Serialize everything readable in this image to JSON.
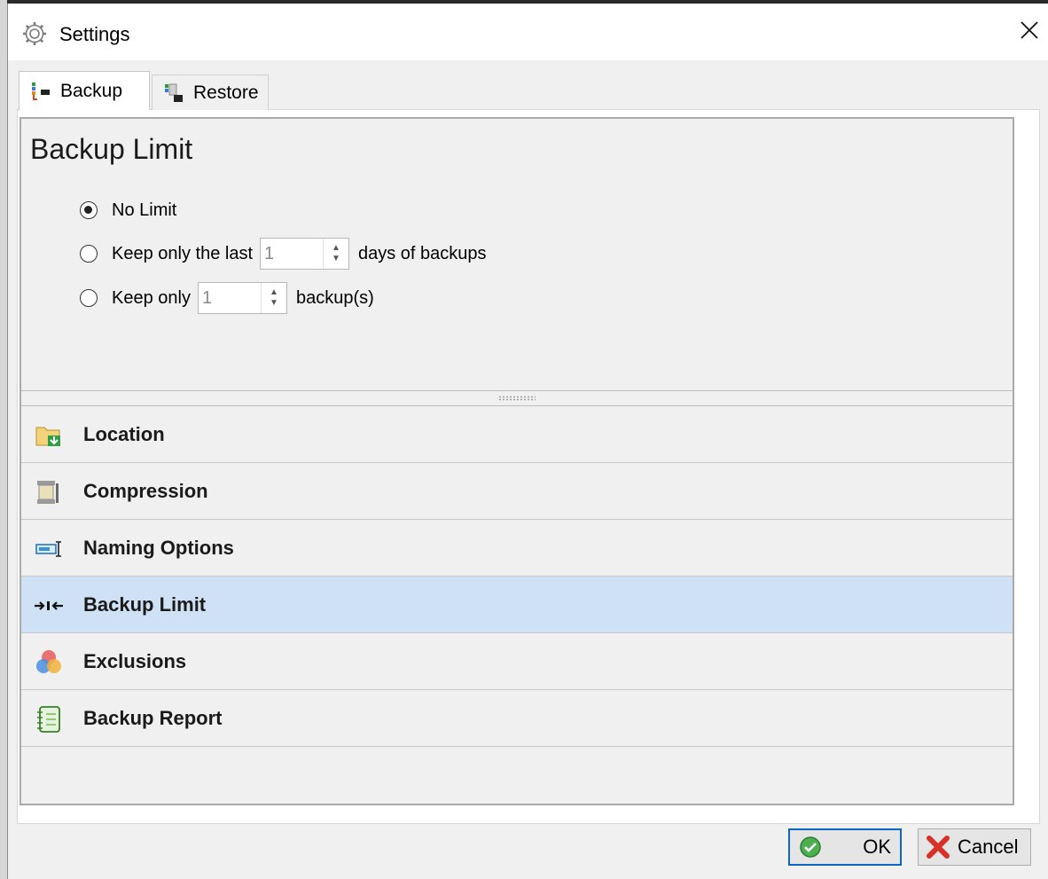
{
  "window": {
    "title": "Settings",
    "close_glyph": "✕"
  },
  "tabs": [
    {
      "label": "Backup",
      "icon": "backup-tab-icon",
      "active": true
    },
    {
      "label": "Restore",
      "icon": "restore-tab-icon",
      "active": false
    }
  ],
  "page": {
    "title": "Backup Limit",
    "options": {
      "no_limit": {
        "label": "No Limit",
        "checked": true
      },
      "keep_days": {
        "label_before": "Keep only the last",
        "value": "1",
        "label_after": "days of backups",
        "checked": false
      },
      "keep_count": {
        "label_before": "Keep only",
        "value": "1",
        "label_after": "backup(s)",
        "checked": false
      }
    }
  },
  "nav": {
    "items": [
      {
        "label": "Location",
        "icon": "folder-arrow-icon"
      },
      {
        "label": "Compression",
        "icon": "vise-icon"
      },
      {
        "label": "Naming Options",
        "icon": "rename-field-icon"
      },
      {
        "label": "Backup Limit",
        "icon": "limit-arrows-icon",
        "selected": true
      },
      {
        "label": "Exclusions",
        "icon": "venn-circles-icon"
      },
      {
        "label": "Backup Report",
        "icon": "notebook-icon"
      }
    ]
  },
  "footer": {
    "ok_label": "OK",
    "cancel_label": "Cancel"
  },
  "colors": {
    "selected_row": "#cfe2f5",
    "ok_border": "#0a66c2",
    "background": "#f0f0f0"
  }
}
